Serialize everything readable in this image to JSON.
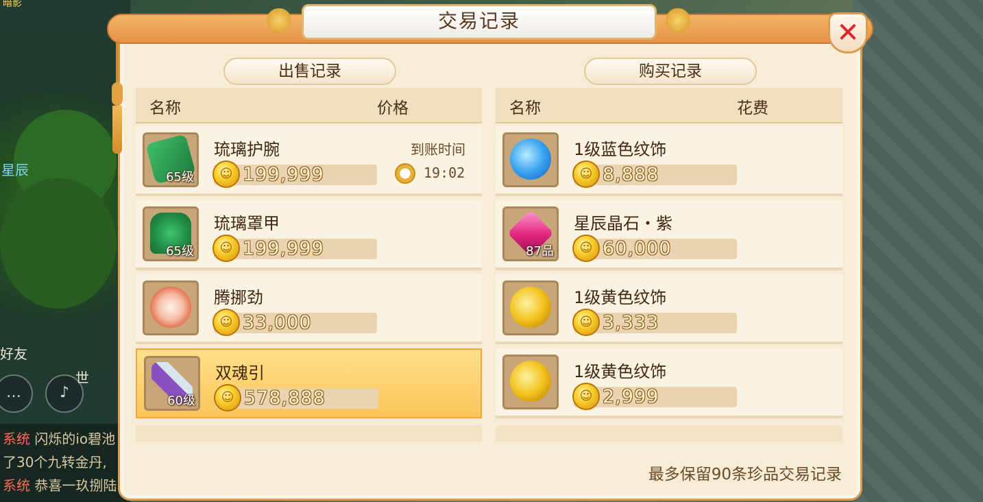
{
  "window": {
    "title": "交易记录",
    "close_icon": "close-x-icon",
    "close_color": "#e0242a"
  },
  "sell": {
    "header": "出售记录",
    "col_name": "名称",
    "col_price": "价格",
    "items": [
      {
        "name": "琉璃护腕",
        "level": "65级",
        "price": "199,999",
        "arrival_label": "到账时间",
        "arrival_time": "19:02",
        "icon": "bracer-icon",
        "selected": false
      },
      {
        "name": "琉璃罩甲",
        "level": "65级",
        "price": "199,999",
        "icon": "armor-icon",
        "selected": false
      },
      {
        "name": "腾挪劲",
        "level": "",
        "price": "33,000",
        "icon": "skill-orb-icon",
        "selected": false
      },
      {
        "name": "双魂引",
        "level": "60级",
        "price": "578,888",
        "icon": "flute-icon",
        "selected": true
      }
    ]
  },
  "buy": {
    "header": "购买记录",
    "col_name": "名称",
    "col_cost": "花费",
    "items": [
      {
        "name": "1级蓝色纹饰",
        "level": "",
        "price": "8,888",
        "icon": "blue-gem-icon"
      },
      {
        "name": "星辰晶石・紫",
        "level": "87品",
        "price": "60,000",
        "icon": "purple-crystal-icon"
      },
      {
        "name": "1级黄色纹饰",
        "level": "",
        "price": "3,333",
        "icon": "gold-gem-icon"
      },
      {
        "name": "1级黄色纹饰",
        "level": "",
        "price": "2,999",
        "icon": "gold-gem-icon"
      }
    ]
  },
  "footer_note": "最多保留90条珍品交易记录",
  "background": {
    "chat": [
      {
        "tag": "系统",
        "text": "闪烁的io碧池"
      },
      {
        "tag": "",
        "text": "了30个九转金丹,"
      },
      {
        "tag": "系统",
        "text": "恭喜一玖捌陆"
      }
    ],
    "world_label": "世",
    "friend_label": "好友",
    "player_label": "星辰",
    "corner_label": "暗影"
  },
  "colors": {
    "accent": "#e59346",
    "panel": "#f7ecd6",
    "selected_row": "#fbc55a",
    "coin": "#f7cf2e"
  }
}
